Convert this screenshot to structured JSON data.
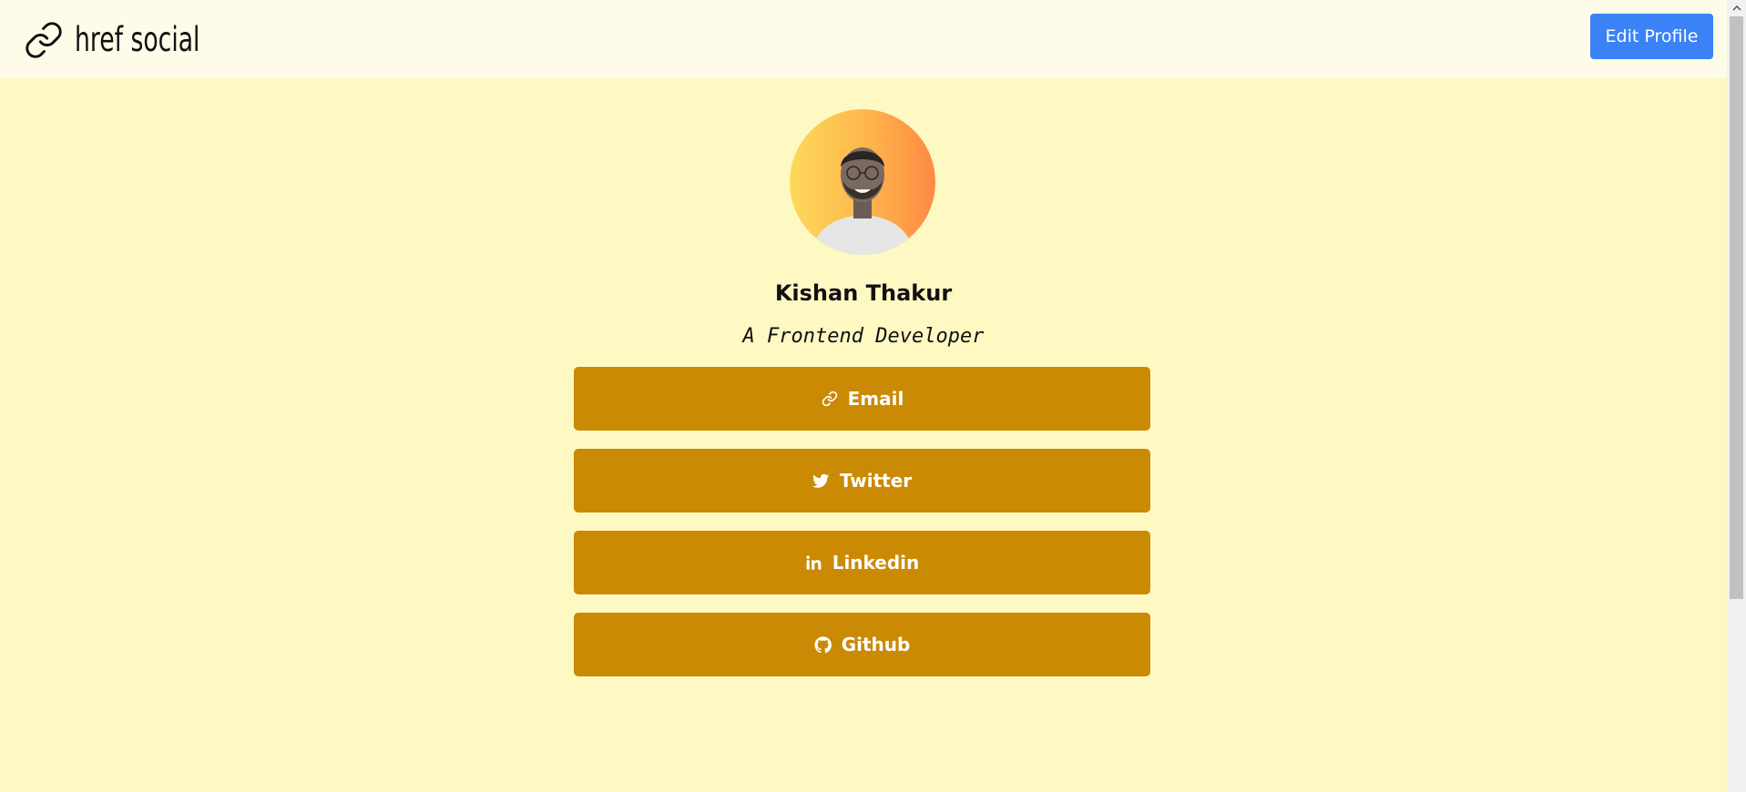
{
  "navbar": {
    "brand_text": "href social",
    "brand_icon": "link-icon",
    "edit_button_label": "Edit Profile"
  },
  "profile": {
    "name": "Kishan Thakur",
    "tagline": "A Frontend Developer"
  },
  "links": [
    {
      "label": "Email",
      "icon": "link-icon"
    },
    {
      "label": "Twitter",
      "icon": "twitter-icon"
    },
    {
      "label": "Linkedin",
      "icon": "linkedin-icon"
    },
    {
      "label": "Github",
      "icon": "github-icon"
    }
  ],
  "colors": {
    "page_background": "#fef9c3",
    "navbar_background": "#fefce8",
    "edit_button": "#3b82f6",
    "link_button": "#ca8a04",
    "link_text": "#ffffff"
  }
}
